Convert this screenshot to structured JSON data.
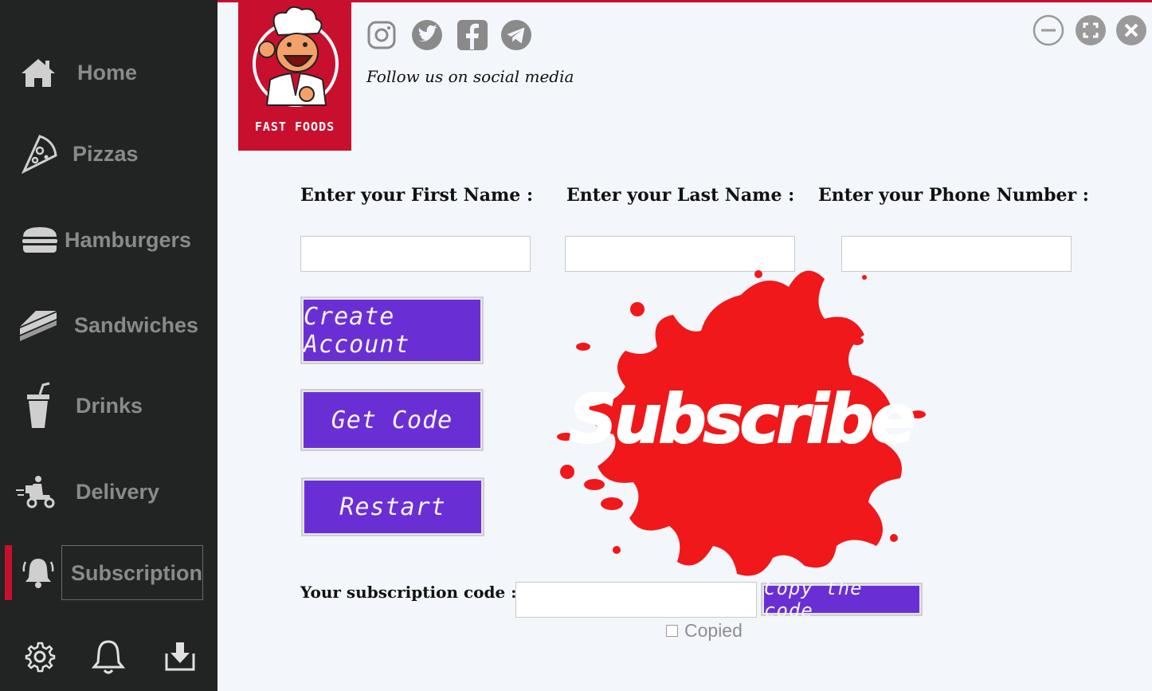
{
  "sidebar": {
    "items": [
      {
        "label": "Home",
        "icon": "home-icon"
      },
      {
        "label": "Pizzas",
        "icon": "pizza-icon"
      },
      {
        "label": "Hamburgers",
        "icon": "hamburger-icon"
      },
      {
        "label": "Sandwiches",
        "icon": "sandwich-icon"
      },
      {
        "label": "Drinks",
        "icon": "drink-icon"
      },
      {
        "label": "Delivery",
        "icon": "delivery-icon"
      },
      {
        "label": "Subscription",
        "icon": "bell-ring-icon"
      }
    ],
    "active": "Subscription",
    "bottom_icons": [
      "settings-gear-icon",
      "notification-bell-icon",
      "download-icon"
    ]
  },
  "logo": {
    "text": "FAST FOODS"
  },
  "social": {
    "icons": [
      "instagram-icon",
      "twitter-icon",
      "facebook-icon",
      "telegram-icon"
    ],
    "follow_text": "Follow us on social media"
  },
  "window_controls": [
    "minimize-icon",
    "maximize-icon",
    "close-icon"
  ],
  "form": {
    "first_name_label": "Enter your First Name :",
    "last_name_label": "Enter your Last Name :",
    "phone_label": "Enter your Phone Number :",
    "first_name_value": "",
    "last_name_value": "",
    "phone_value": ""
  },
  "buttons": {
    "create_account": "Create Account",
    "get_code": "Get Code",
    "restart": "Restart",
    "copy_code": "Copy the code"
  },
  "subscription": {
    "code_label": "Your subscription code :",
    "code_value": "",
    "copied_label": "Copied",
    "copied_checked": false,
    "splash_text": "Subscribe"
  },
  "colors": {
    "sidebar_bg": "#222323",
    "accent_red": "#c8102e",
    "button_purple": "#6a2fd4",
    "splash_red": "#f0181a",
    "content_bg": "#f3f6fa"
  }
}
